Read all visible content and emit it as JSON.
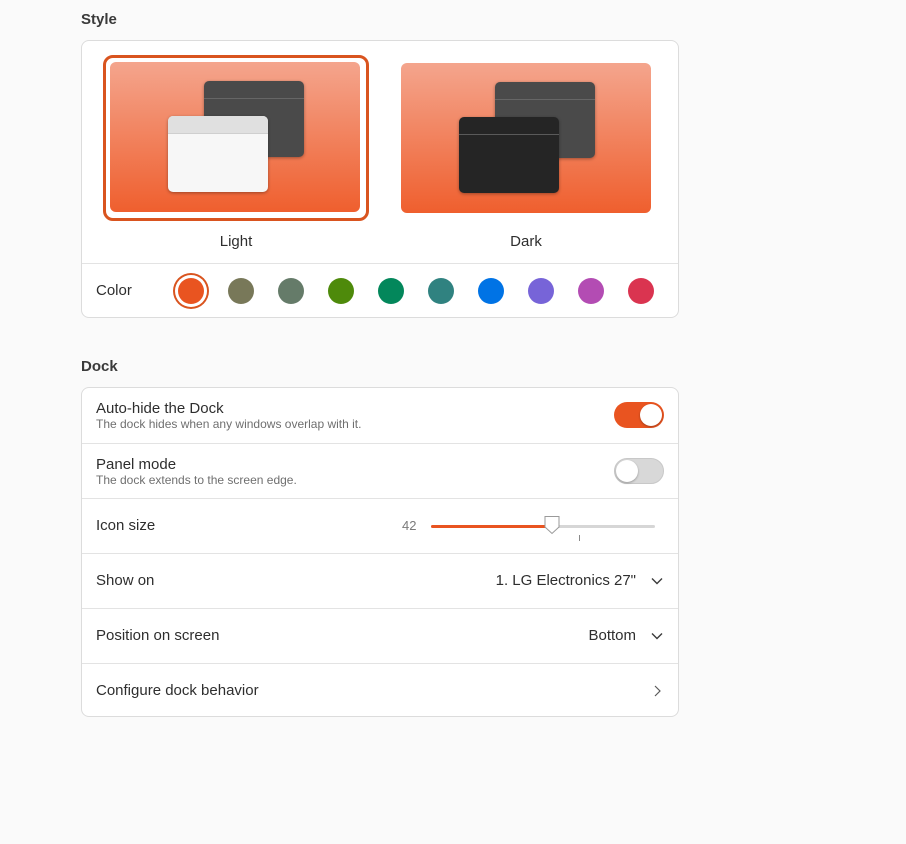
{
  "style": {
    "section_title": "Style",
    "themes": [
      {
        "label": "Light",
        "selected": true
      },
      {
        "label": "Dark",
        "selected": false
      }
    ],
    "color_label": "Color",
    "accent_colors": [
      "#e95420",
      "#787859",
      "#657b69",
      "#4e8a0b",
      "#03875b",
      "#308280",
      "#0073e5",
      "#7764d8",
      "#b34cb3",
      "#da3450"
    ],
    "selected_color": "#e95420"
  },
  "dock": {
    "section_title": "Dock",
    "auto_hide": {
      "title": "Auto-hide the Dock",
      "subtitle": "The dock hides when any windows overlap with it.",
      "enabled": true
    },
    "panel_mode": {
      "title": "Panel mode",
      "subtitle": "The dock extends to the screen edge.",
      "enabled": false
    },
    "icon_size": {
      "title": "Icon size",
      "value": "42",
      "fraction": 0.54
    },
    "show_on": {
      "title": "Show on",
      "value": "1. LG Electronics 27\""
    },
    "position": {
      "title": "Position on screen",
      "value": "Bottom"
    },
    "configure": {
      "title": "Configure dock behavior"
    }
  },
  "icons": [
    "chevron-down-icon",
    "chevron-right-icon",
    "slider-knob-icon"
  ]
}
